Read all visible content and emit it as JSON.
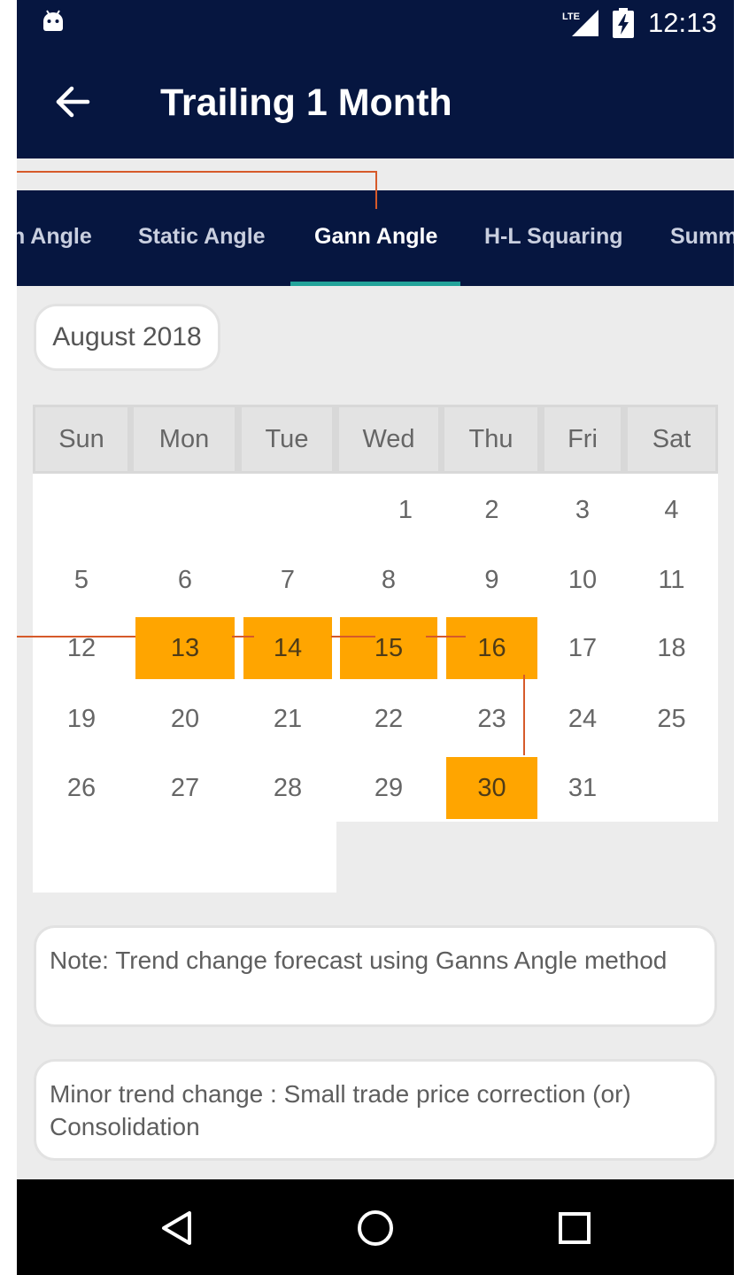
{
  "status_bar": {
    "time": "12:13",
    "network": "LTE",
    "icons": [
      "android-debug-icon",
      "lte-signal-icon",
      "battery-charging-icon"
    ]
  },
  "app_bar": {
    "title": "Trailing 1 Month",
    "back_icon": "arrow-left-icon"
  },
  "tabs": [
    {
      "label": "n Angle",
      "active": false
    },
    {
      "label": "Static Angle",
      "active": false
    },
    {
      "label": "Gann Angle",
      "active": true
    },
    {
      "label": "H-L Squaring",
      "active": false
    },
    {
      "label": "Summ",
      "active": false
    }
  ],
  "month_label": "August 2018",
  "calendar": {
    "weekdays": [
      "Sun",
      "Mon",
      "Tue",
      "Wed",
      "Thu",
      "Fri",
      "Sat"
    ],
    "days": [
      "1",
      "2",
      "3",
      "4",
      "5",
      "6",
      "7",
      "8",
      "9",
      "10",
      "11",
      "12",
      "13",
      "14",
      "15",
      "16",
      "17",
      "18",
      "19",
      "20",
      "21",
      "22",
      "23",
      "24",
      "25",
      "26",
      "27",
      "28",
      "29",
      "30",
      "31"
    ],
    "highlighted_days": [
      "13",
      "14",
      "15",
      "16",
      "30"
    ],
    "highlight_color": "#ffa500",
    "connector_color": "#d65a2a"
  },
  "notes": [
    "Note: Trend change forecast using Ganns Angle method",
    "Minor trend change : Small trade price correction (or) Consolidation"
  ],
  "nav_bar": {
    "icons": [
      "back-triangle-icon",
      "home-circle-icon",
      "recents-square-icon"
    ]
  },
  "colors": {
    "primary": "#061640",
    "accent": "#22a39a",
    "background": "#ececec"
  }
}
